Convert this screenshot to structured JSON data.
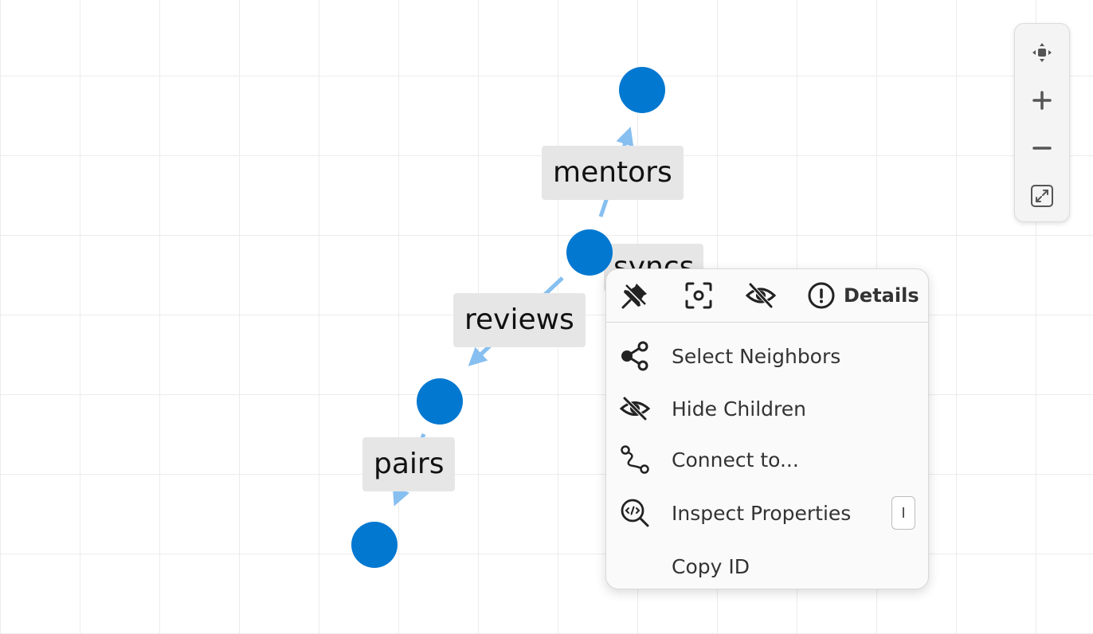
{
  "graph": {
    "edge_labels": {
      "mentors": "mentors",
      "syncs": "syncs",
      "reviews": "reviews",
      "pairs": "pairs"
    }
  },
  "zoom_controls": {
    "icons": [
      "recenter-icon",
      "zoom-in-icon",
      "zoom-out-icon",
      "fit-view-icon"
    ]
  },
  "context_menu": {
    "toolbar": {
      "details_label": "Details",
      "icons": [
        "pin-icon",
        "focus-icon",
        "hide-icon",
        "info-icon"
      ]
    },
    "items": [
      {
        "label": "Select Neighbors",
        "icon": "share-icon"
      },
      {
        "label": "Hide Children",
        "icon": "eye-off-icon"
      },
      {
        "label": "Connect to...",
        "icon": "route-icon"
      },
      {
        "label": "Inspect Properties",
        "icon": "inspect-icon",
        "shortcut": "I"
      },
      {
        "label": "Copy ID"
      }
    ]
  },
  "colors": {
    "node": "#0278d1",
    "edge": "#86bff0",
    "label_bg": "#e6e6e6",
    "grid": "#ececec"
  }
}
